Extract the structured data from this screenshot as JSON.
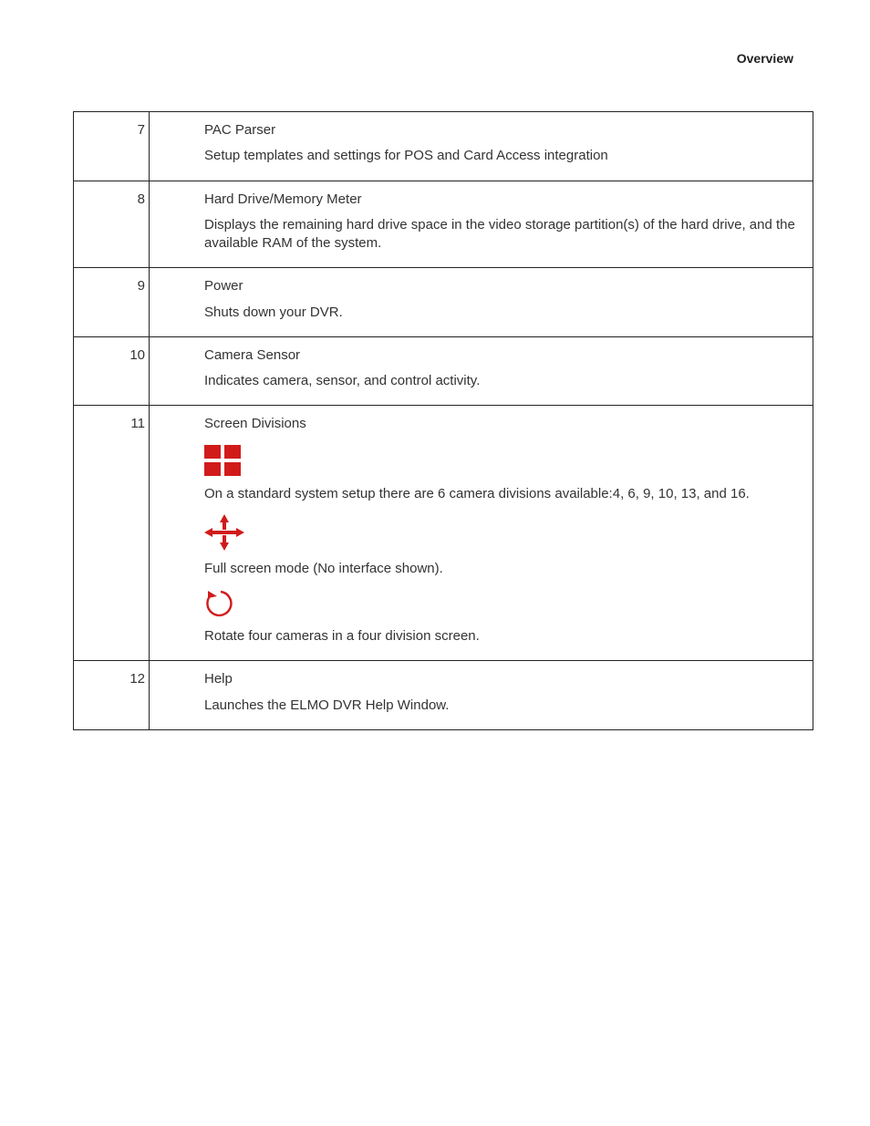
{
  "header": {
    "title": "Overview"
  },
  "rows": [
    {
      "num": "7",
      "title": "PAC Parser",
      "desc1": "Setup templates and settings for POS and Card Access integration"
    },
    {
      "num": "8",
      "title": "Hard Drive/Memory Meter",
      "desc1": "Displays the remaining hard drive space in the video storage partition(s) of the hard drive, and the available RAM of the system."
    },
    {
      "num": "9",
      "title": "Power",
      "desc1": "Shuts down your DVR."
    },
    {
      "num": "10",
      "title": "Camera Sensor",
      "desc1": "Indicates camera, sensor, and control activity."
    },
    {
      "num": "11",
      "title": "Screen Divisions",
      "desc1": "On a standard system setup there are 6 camera divisions available:4, 6, 9, 10, 13, and 16.",
      "desc2": "Full screen mode (No interface shown).",
      "desc3": "Rotate four cameras in a four division screen."
    },
    {
      "num": "12",
      "title": "Help",
      "desc1": "Launches the ELMO DVR Help Window."
    }
  ]
}
